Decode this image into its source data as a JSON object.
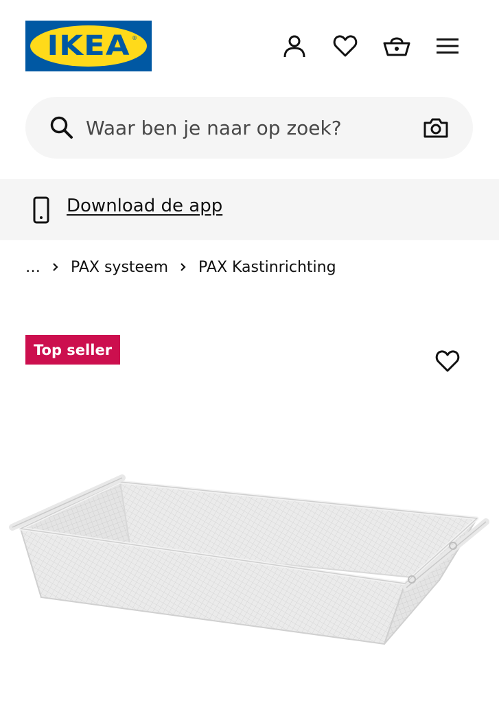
{
  "header": {
    "logo_text": "IKEA",
    "logo_reg": "®",
    "colors": {
      "brand_blue": "#0058a3",
      "brand_yellow": "#ffda1a"
    },
    "icons": [
      "user-icon",
      "heart-icon",
      "basket-icon",
      "menu-icon"
    ]
  },
  "search": {
    "placeholder": "Waar ben je naar op zoek?",
    "icon": "search-icon",
    "camera_icon": "camera-icon"
  },
  "app_banner": {
    "label": "Download de app",
    "icon": "phone-icon"
  },
  "breadcrumb": {
    "items": [
      "…",
      "PAX systeem",
      "PAX Kastinrichting"
    ]
  },
  "product": {
    "badge": "Top seller",
    "badge_color": "#cc0f4e",
    "favorite_icon": "heart-icon",
    "image": "wire-mesh-basket"
  }
}
